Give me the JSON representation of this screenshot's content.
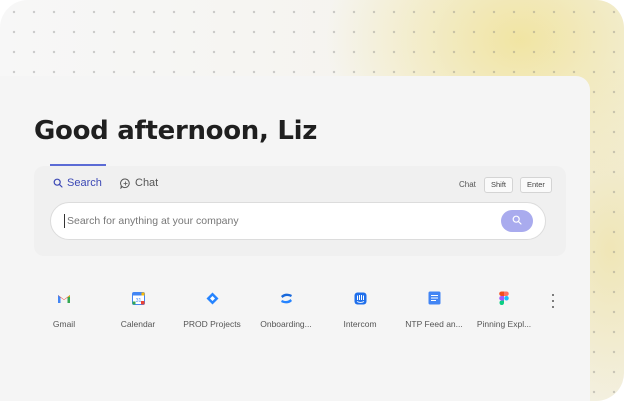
{
  "greeting": "Good afternoon, Liz",
  "tabs": {
    "search": "Search",
    "chat": "Chat"
  },
  "shortcut": {
    "label": "Chat",
    "keys": [
      "Shift",
      "Enter"
    ]
  },
  "search": {
    "placeholder": "Search for anything at your company"
  },
  "apps": [
    {
      "label": "Gmail",
      "icon": "gmail-icon"
    },
    {
      "label": "Calendar",
      "icon": "calendar-icon"
    },
    {
      "label": "PROD Projects",
      "icon": "jira-icon"
    },
    {
      "label": "Onboarding...",
      "icon": "confluence-icon"
    },
    {
      "label": "Intercom",
      "icon": "intercom-icon"
    },
    {
      "label": "NTP Feed an...",
      "icon": "docs-icon"
    },
    {
      "label": "Pinning Expl...",
      "icon": "figma-icon"
    }
  ],
  "colors": {
    "accent": "#3b48b5",
    "search_button": "#a9abee"
  }
}
